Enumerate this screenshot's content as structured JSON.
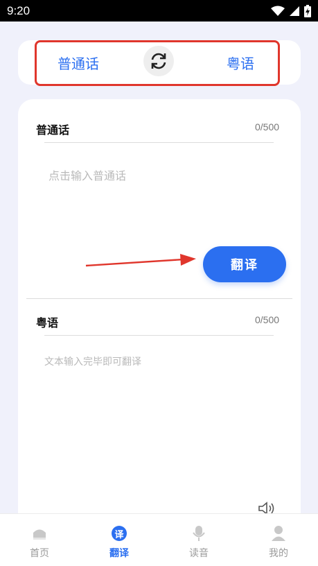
{
  "status_bar": {
    "time": "9:20"
  },
  "lang_bar": {
    "source": "普通话",
    "target": "粤语"
  },
  "source_section": {
    "title": "普通话",
    "count": "0/500",
    "placeholder": "点击输入普通话"
  },
  "translate_button": {
    "label": "翻译"
  },
  "target_section": {
    "title": "粤语",
    "count": "0/500",
    "placeholder": "文本输入完毕即可翻译"
  },
  "bottom_nav": {
    "items": [
      {
        "label": "首页",
        "icon": "home-icon"
      },
      {
        "label": "翻译",
        "icon": "translate-icon",
        "active": true
      },
      {
        "label": "读音",
        "icon": "microphone-icon"
      },
      {
        "label": "我的",
        "icon": "profile-icon"
      }
    ],
    "translate_icon_glyph": "译"
  },
  "colors": {
    "accent": "#2b6ff0",
    "highlight": "#e0362c",
    "background": "#f0f1fb"
  }
}
